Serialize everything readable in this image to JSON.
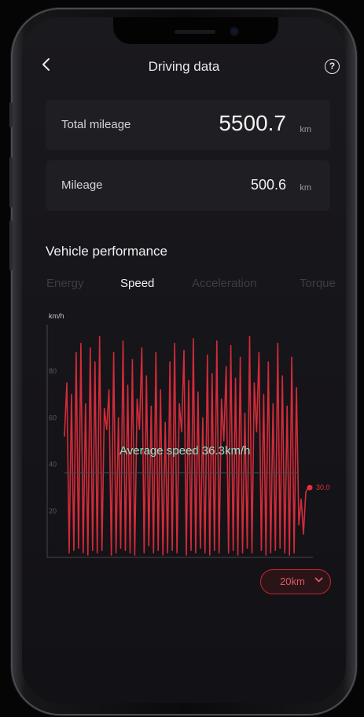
{
  "header": {
    "title": "Driving data",
    "back_icon": "chevron-left-icon",
    "help_icon": "question-circle-icon"
  },
  "summary": {
    "total_mileage": {
      "label": "Total mileage",
      "value": "5500.7",
      "unit": "km"
    },
    "mileage": {
      "label": "Mileage",
      "value": "500.6",
      "unit": "km"
    }
  },
  "performance": {
    "title": "Vehicle performance",
    "tabs": [
      "Energy",
      "Speed",
      "Acceleration",
      "Torque"
    ],
    "active_tab": "Speed",
    "average_label": "Average speed 36.3km/h",
    "range_selector": "20km"
  },
  "colors": {
    "accent": "#d42b3a",
    "average_text": "#8fe3c8",
    "background": "#151418"
  },
  "chart_data": {
    "type": "line",
    "ylabel": "km/h",
    "ylim": [
      0,
      100
    ],
    "yticks": [
      20,
      40,
      60,
      80
    ],
    "grid": false,
    "average": 36.3,
    "last_value_label": "30.0",
    "series": [
      {
        "values": [
          52,
          75,
          2,
          70,
          3,
          88,
          4,
          92,
          2,
          66,
          1,
          90,
          3,
          84,
          2,
          95,
          3,
          64,
          55,
          72,
          1,
          88,
          2,
          60,
          4,
          93,
          3,
          74,
          2,
          85,
          1,
          68,
          55,
          90,
          2,
          78,
          5,
          65,
          2,
          88,
          3,
          72,
          1,
          58,
          2,
          84,
          3,
          92,
          2,
          66,
          54,
          89,
          1,
          76,
          3,
          94,
          2,
          71,
          4,
          60,
          2,
          87,
          1,
          79,
          3,
          93,
          2,
          68,
          50,
          82,
          2,
          91,
          3,
          77,
          1,
          86,
          2,
          62,
          4,
          95,
          2,
          75,
          54,
          88,
          3,
          70,
          1,
          84,
          2,
          66,
          3,
          92,
          4,
          78,
          2,
          65,
          1,
          86,
          2,
          73,
          14,
          25,
          10,
          28,
          30
        ]
      }
    ]
  }
}
